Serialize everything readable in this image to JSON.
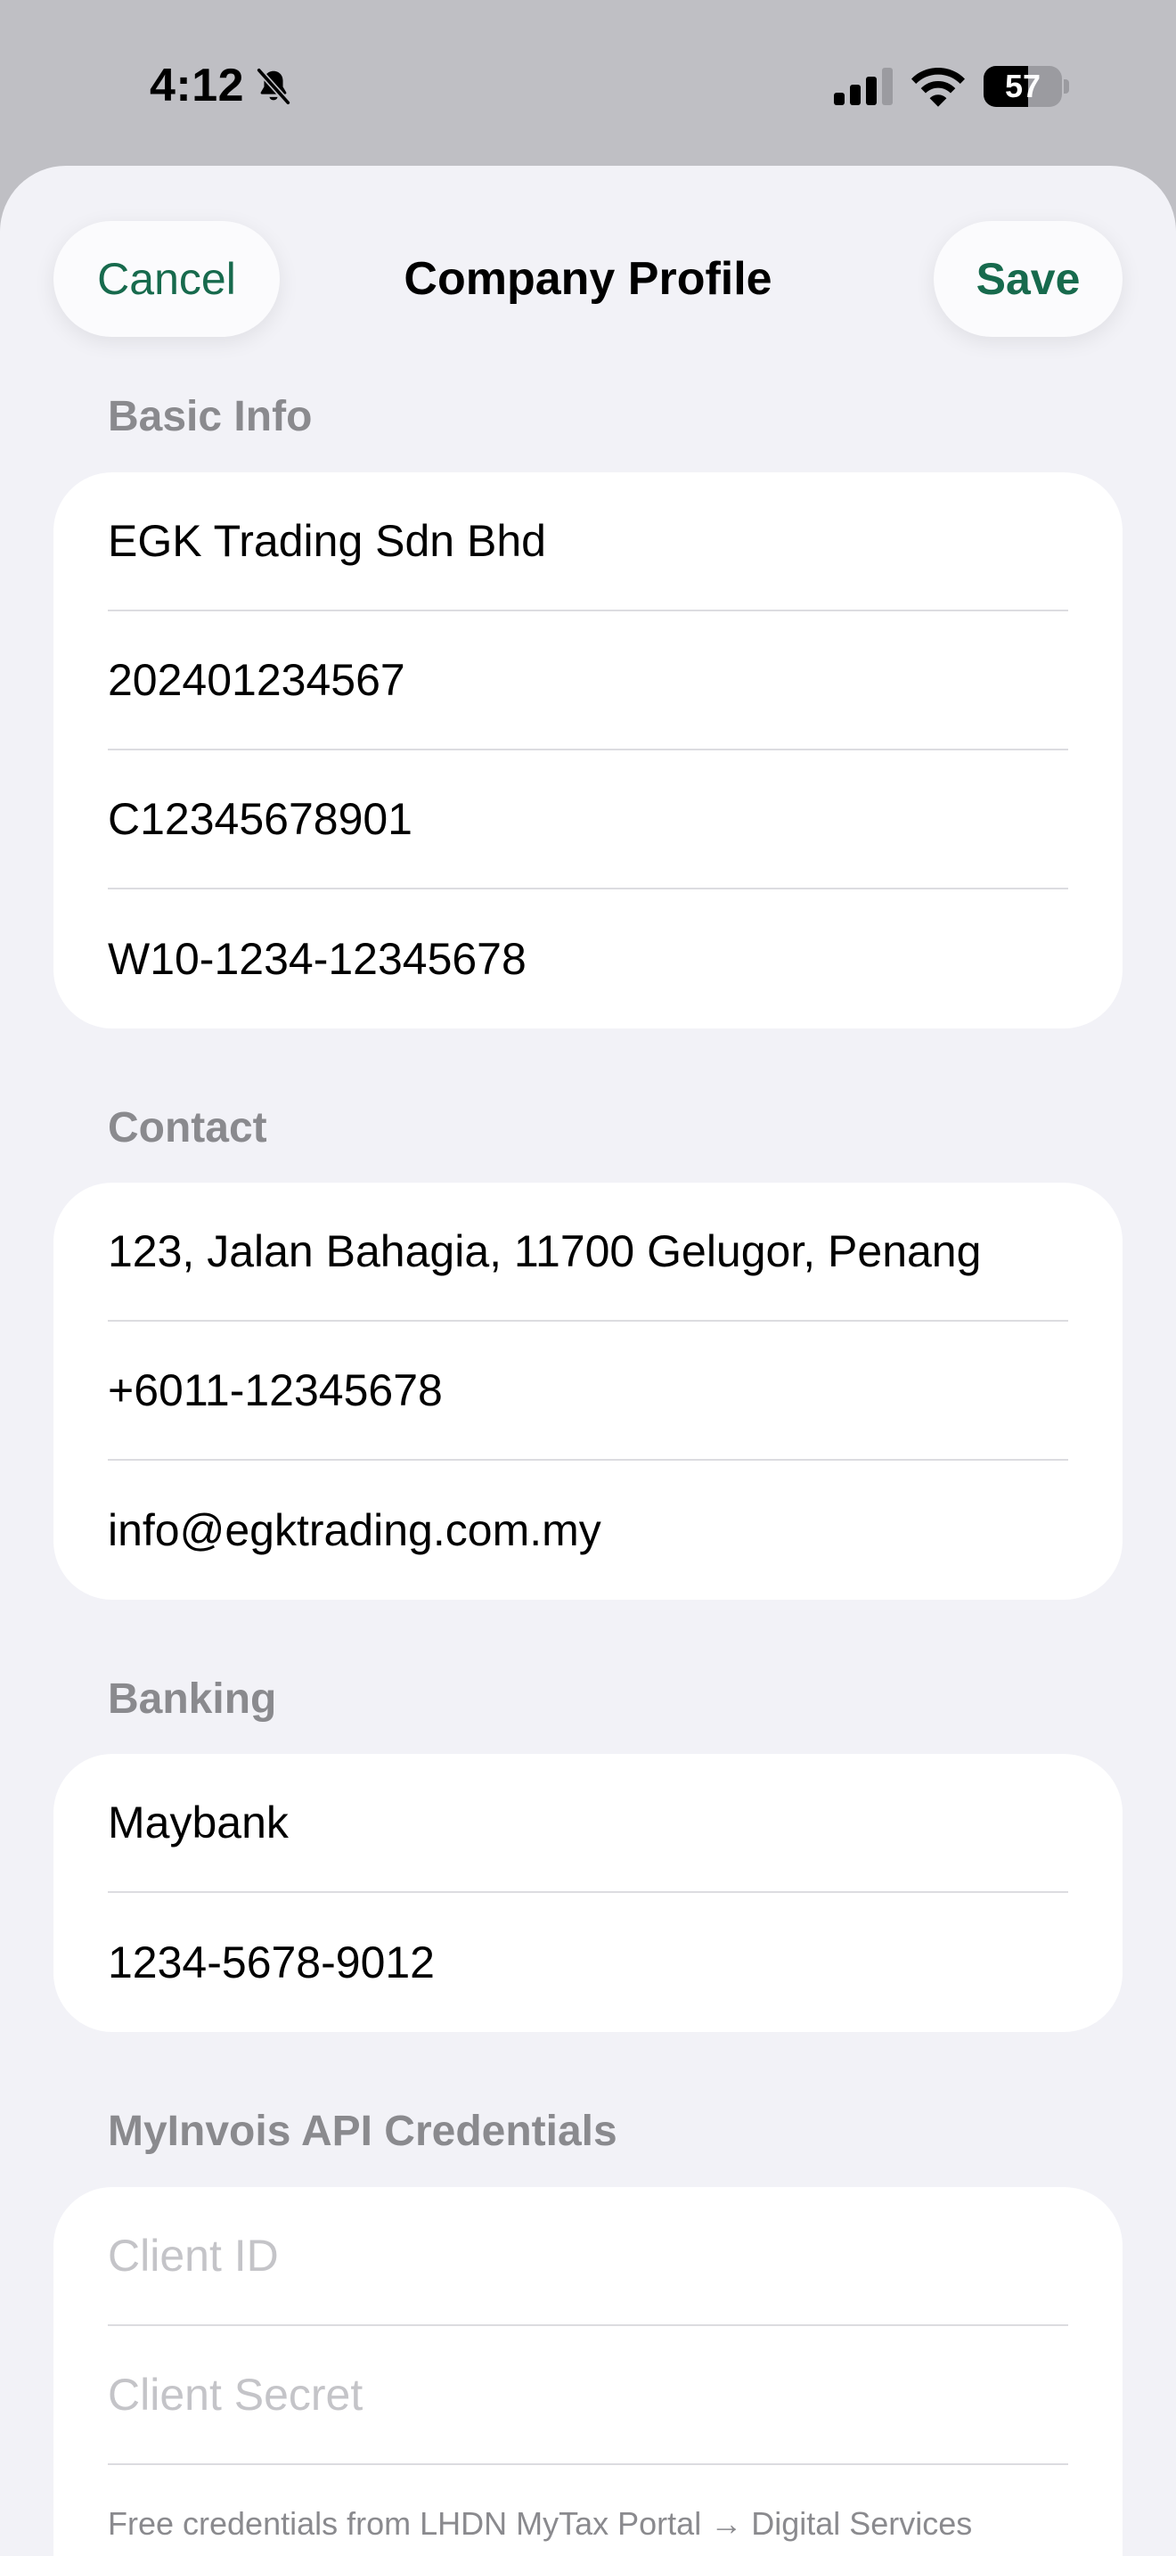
{
  "status_bar": {
    "time": "4:12",
    "battery_level": 57,
    "battery_label": "57"
  },
  "nav": {
    "cancel_label": "Cancel",
    "title": "Company Profile",
    "save_label": "Save",
    "accent_color": "#176a4d"
  },
  "sections": {
    "basic": {
      "header": "Basic Info",
      "company_name": "EGK Trading Sdn Bhd",
      "registration_no": "202401234567",
      "tin": "C12345678901",
      "sst_no": "W10-1234-12345678"
    },
    "contact": {
      "header": "Contact",
      "address": "123, Jalan Bahagia, 11700 Gelugor, Penang",
      "phone": "+6011-12345678",
      "email": "info@egktrading.com.my"
    },
    "banking": {
      "header": "Banking",
      "bank_name": "Maybank",
      "account_no": "1234-5678-9012"
    },
    "api": {
      "header": "MyInvois API Credentials",
      "client_id_placeholder": "Client ID",
      "client_secret_placeholder": "Client Secret",
      "footnote": "Free credentials from LHDN MyTax Portal → Digital Services"
    }
  },
  "icons": [
    "bell-slash-icon",
    "cellular-signal-icon",
    "wifi-icon",
    "battery-icon"
  ]
}
